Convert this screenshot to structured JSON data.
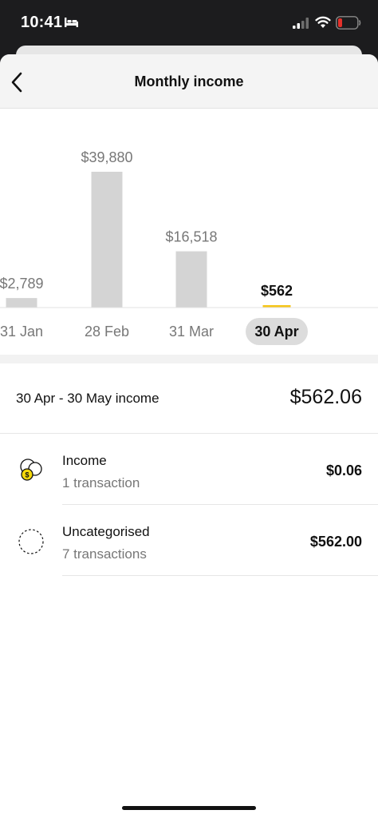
{
  "status_bar": {
    "time": "10:41"
  },
  "header": {
    "title": "Monthly income"
  },
  "chart_data": {
    "type": "bar",
    "categories": [
      "31 Jan",
      "28 Feb",
      "31 Mar",
      "30 Apr"
    ],
    "values": [
      2789,
      39880,
      16518,
      562
    ],
    "value_labels": [
      "$2,789",
      "$39,880",
      "$16,518",
      "$562"
    ],
    "selected_index": 3,
    "colors": {
      "bar": "#d4d4d4",
      "selected_bar": "#f5c518",
      "selected_pill": "#dcdcdc"
    }
  },
  "summary": {
    "label": "30 Apr - 30 May income",
    "amount": "$562.06"
  },
  "categories": [
    {
      "name": "Income",
      "count": "1 transaction",
      "amount": "$0.06",
      "icon": "coins-icon"
    },
    {
      "name": "Uncategorised",
      "count": "7 transactions",
      "amount": "$562.00",
      "icon": "dashed-circle-icon"
    }
  ]
}
